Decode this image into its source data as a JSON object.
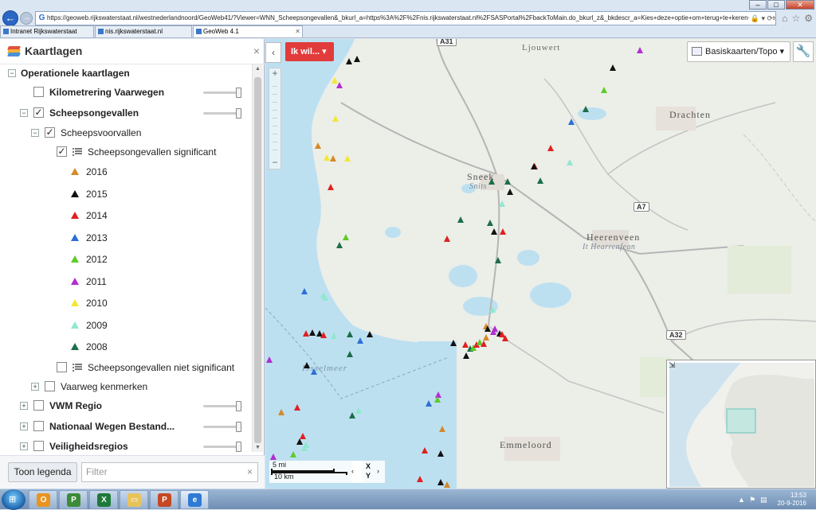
{
  "browser": {
    "url": "https://geoweb.rijkswaterstaat.nl/westnederlandnoord/GeoWeb41/?Viewer=WNN_Scheepsongevallen&_bkurl_a=https%3A%2F%2Fnis.rijkswaterstaat.nl%2FSASPortal%2FbackToMain.do_bkurl_z&_bkdescr_a=Kies+deze+optie+om+terug+te+keren+naar+de+portaalpagin",
    "tabs": [
      {
        "label": "Intranet Rijkswaterstaat"
      },
      {
        "label": "nis.rijkswaterstaat.nl"
      },
      {
        "label": "GeoWeb 4.1"
      }
    ]
  },
  "panel": {
    "title": "Kaartlagen",
    "close": "×",
    "legend_button": "Toon legenda",
    "filter_placeholder": "Filter",
    "filter_clear": "×"
  },
  "tree": {
    "operational": "Operationele kaartlagen",
    "kilometrering": "Kilometrering Vaarwegen",
    "scheepsongevallen": "Scheepsongevallen",
    "scheepsvoorvallen": "Scheepsvoorvallen",
    "significant": "Scheepsongevallen significant",
    "niet_significant": "Scheepsongevallen niet significant",
    "vaarweg": "Vaarweg kenmerken",
    "vwm": "VWM Regio",
    "nwb": "Nationaal Wegen Bestand...",
    "veiligheid": "Veiligheidsregios",
    "check": "✓",
    "minus": "−",
    "plus": "+"
  },
  "legend": [
    {
      "year": "2016",
      "color": "#d4892a"
    },
    {
      "year": "2015",
      "color": "#111111"
    },
    {
      "year": "2014",
      "color": "#e02020"
    },
    {
      "year": "2013",
      "color": "#2e6fd6"
    },
    {
      "year": "2012",
      "color": "#5ecb2a"
    },
    {
      "year": "2011",
      "color": "#b12ed1"
    },
    {
      "year": "2010",
      "color": "#f2e833"
    },
    {
      "year": "2009",
      "color": "#8fe8cf"
    },
    {
      "year": "2008",
      "color": "#1c6e48"
    }
  ],
  "map": {
    "collapse": "‹",
    "ik_wil": "Ik wil... ▾",
    "basemap": "Basiskaarten/Topo ▾",
    "tools_icon": "wrench-icon",
    "zoom_in": "+",
    "zoom_out": "−",
    "labels": {
      "ljouwert": "Ljouwert",
      "drachten": "Drachten",
      "sneek": "Sneek",
      "snits": "Snits",
      "heerenveen": "Heerenveen",
      "it_hearrenfean": "It Hearrenfean",
      "ijsselmeer": "IJsselmeer",
      "emmeloord": "Emmeloord"
    },
    "roads": {
      "a31": "A31",
      "a7": "A7",
      "a32": "A32"
    },
    "scale_mi": "5 mi",
    "scale_km": "10 km",
    "coord_x": "X",
    "coord_y": "Y",
    "coord_prev": "‹",
    "coord_next": "›",
    "overview_toggle": "⇲"
  },
  "taskbar": {
    "time": "13:53",
    "date": "20-9-2016"
  }
}
